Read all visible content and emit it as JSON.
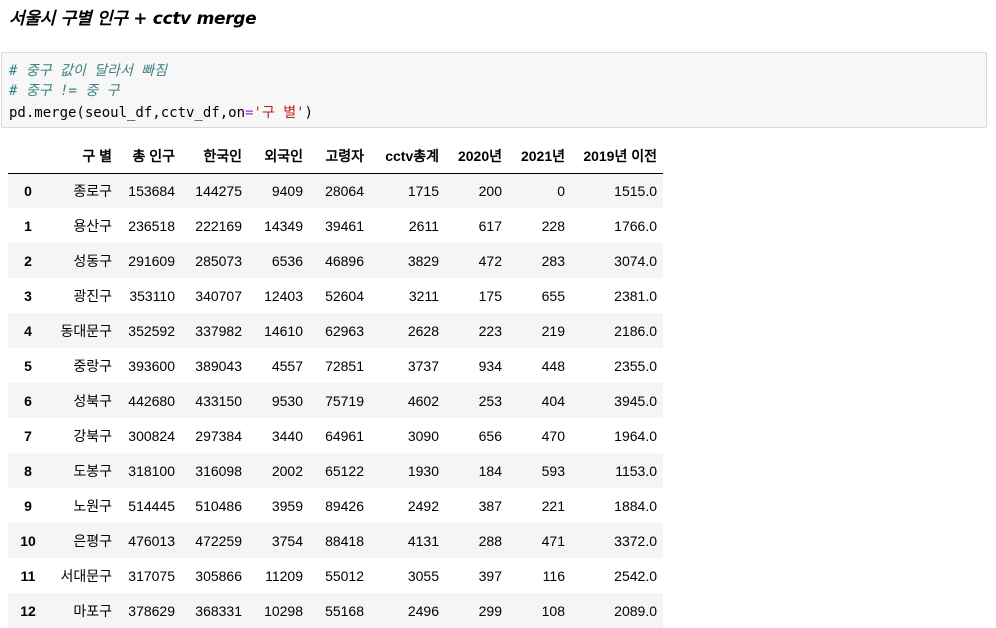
{
  "heading": "서울시 구별 인구 + cctv merge",
  "code": {
    "line1": "# 중구 값이 달라서 빠짐",
    "line2": "# 중구 != 중 구",
    "line3_prefix": "pd.merge(seoul_df,cctv_df,on",
    "line3_eq": "=",
    "line3_str": "'구 별'",
    "line3_suffix": ")"
  },
  "table": {
    "columns": [
      "",
      "구 별",
      "총 인구",
      "한국인",
      "외국인",
      "고령자",
      "cctv총계",
      "2020년",
      "2021년",
      "2019년 이전"
    ],
    "rows": [
      {
        "idx": "0",
        "gu": "종로구",
        "total": "153684",
        "korean": "144275",
        "foreign": "9409",
        "elderly": "28064",
        "cctv": "1715",
        "y2020": "200",
        "y2021": "0",
        "before2019": "1515.0"
      },
      {
        "idx": "1",
        "gu": "용산구",
        "total": "236518",
        "korean": "222169",
        "foreign": "14349",
        "elderly": "39461",
        "cctv": "2611",
        "y2020": "617",
        "y2021": "228",
        "before2019": "1766.0"
      },
      {
        "idx": "2",
        "gu": "성동구",
        "total": "291609",
        "korean": "285073",
        "foreign": "6536",
        "elderly": "46896",
        "cctv": "3829",
        "y2020": "472",
        "y2021": "283",
        "before2019": "3074.0"
      },
      {
        "idx": "3",
        "gu": "광진구",
        "total": "353110",
        "korean": "340707",
        "foreign": "12403",
        "elderly": "52604",
        "cctv": "3211",
        "y2020": "175",
        "y2021": "655",
        "before2019": "2381.0"
      },
      {
        "idx": "4",
        "gu": "동대문구",
        "total": "352592",
        "korean": "337982",
        "foreign": "14610",
        "elderly": "62963",
        "cctv": "2628",
        "y2020": "223",
        "y2021": "219",
        "before2019": "2186.0"
      },
      {
        "idx": "5",
        "gu": "중랑구",
        "total": "393600",
        "korean": "389043",
        "foreign": "4557",
        "elderly": "72851",
        "cctv": "3737",
        "y2020": "934",
        "y2021": "448",
        "before2019": "2355.0"
      },
      {
        "idx": "6",
        "gu": "성북구",
        "total": "442680",
        "korean": "433150",
        "foreign": "9530",
        "elderly": "75719",
        "cctv": "4602",
        "y2020": "253",
        "y2021": "404",
        "before2019": "3945.0"
      },
      {
        "idx": "7",
        "gu": "강북구",
        "total": "300824",
        "korean": "297384",
        "foreign": "3440",
        "elderly": "64961",
        "cctv": "3090",
        "y2020": "656",
        "y2021": "470",
        "before2019": "1964.0"
      },
      {
        "idx": "8",
        "gu": "도봉구",
        "total": "318100",
        "korean": "316098",
        "foreign": "2002",
        "elderly": "65122",
        "cctv": "1930",
        "y2020": "184",
        "y2021": "593",
        "before2019": "1153.0"
      },
      {
        "idx": "9",
        "gu": "노원구",
        "total": "514445",
        "korean": "510486",
        "foreign": "3959",
        "elderly": "89426",
        "cctv": "2492",
        "y2020": "387",
        "y2021": "221",
        "before2019": "1884.0"
      },
      {
        "idx": "10",
        "gu": "은평구",
        "total": "476013",
        "korean": "472259",
        "foreign": "3754",
        "elderly": "88418",
        "cctv": "4131",
        "y2020": "288",
        "y2021": "471",
        "before2019": "3372.0"
      },
      {
        "idx": "11",
        "gu": "서대문구",
        "total": "317075",
        "korean": "305866",
        "foreign": "11209",
        "elderly": "55012",
        "cctv": "3055",
        "y2020": "397",
        "y2021": "116",
        "before2019": "2542.0"
      },
      {
        "idx": "12",
        "gu": "마포구",
        "total": "378629",
        "korean": "368331",
        "foreign": "10298",
        "elderly": "55168",
        "cctv": "2496",
        "y2020": "299",
        "y2021": "108",
        "before2019": "2089.0"
      }
    ]
  }
}
